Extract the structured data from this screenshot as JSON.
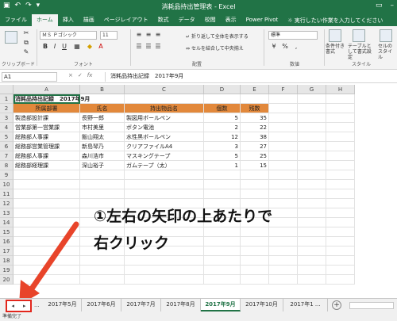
{
  "app": {
    "title": "消耗品持出管理表 - Excel",
    "qat_icons": [
      "save-icon",
      "undo-icon",
      "redo-icon",
      "customize-icon"
    ]
  },
  "ribbon": {
    "tabs": [
      "ファイル",
      "ホーム",
      "挿入",
      "描画",
      "ページレイアウト",
      "数式",
      "データ",
      "校閲",
      "表示",
      "Power Pivot"
    ],
    "active_tab": "ホーム",
    "tell_me": "実行したい作業を入力してください",
    "font_name": "ＭＳ Ｐゴシック",
    "font_size": "11",
    "wrap_text": "折り返して全体を表示する",
    "merge_center": "セルを結合して中央揃え",
    "number_format": "標準",
    "cond_format": "条件付き書式",
    "table_format": "テーブルとして書式設定",
    "cell_style": "セルのスタイル",
    "groups": {
      "clipboard": "クリップボード",
      "font": "フォント",
      "alignment": "配置",
      "number": "数値",
      "styles": "スタイル"
    }
  },
  "formula_bar": {
    "name_box": "A1",
    "formula": "消耗品持出記録　2017年9月"
  },
  "grid": {
    "columns": [
      "A",
      "B",
      "C",
      "D",
      "E",
      "F",
      "G",
      "H"
    ],
    "rows": [
      "1",
      "2",
      "3",
      "4",
      "5",
      "6",
      "7",
      "8",
      "9",
      "10",
      "11",
      "12",
      "13",
      "14",
      "15",
      "16",
      "17",
      "18",
      "19",
      "20"
    ],
    "sheet_title": "消耗品持出記録　2017年9月",
    "headers": [
      "所属部署",
      "氏名",
      "持出物品名",
      "個数",
      "残数"
    ],
    "data": [
      [
        "製造部設計課",
        "長野一郎",
        "製図用ボールペン",
        "5",
        "35"
      ],
      [
        "営業部第一営業課",
        "市村美里",
        "ボタン電池",
        "2",
        "22"
      ],
      [
        "総務部人事課",
        "飯山翔太",
        "水性黒ボールペン",
        "12",
        "38"
      ],
      [
        "総務部営業管理課",
        "新島琴乃",
        "クリアファイルA4",
        "3",
        "27"
      ],
      [
        "総務部人事課",
        "森川浩市",
        "マスキングテープ",
        "5",
        "25"
      ],
      [
        "総務部経理課",
        "深山裕子",
        "ガムテープ（太）",
        "1",
        "15"
      ]
    ]
  },
  "annotation": {
    "line1": "①左右の矢印の上あたりで",
    "line2": "右クリック",
    "arrow_color": "#e8442a"
  },
  "sheets": {
    "nav_prev": "◂",
    "nav_next": "▸",
    "ellipsis": "...",
    "tabs": [
      "2017年5月",
      "2017年6月",
      "2017年7月",
      "2017年8月",
      "2017年9月",
      "2017年10月",
      "2017年1 ..."
    ],
    "active": "2017年9月",
    "add": "+"
  },
  "status": {
    "text": "準備完了"
  }
}
